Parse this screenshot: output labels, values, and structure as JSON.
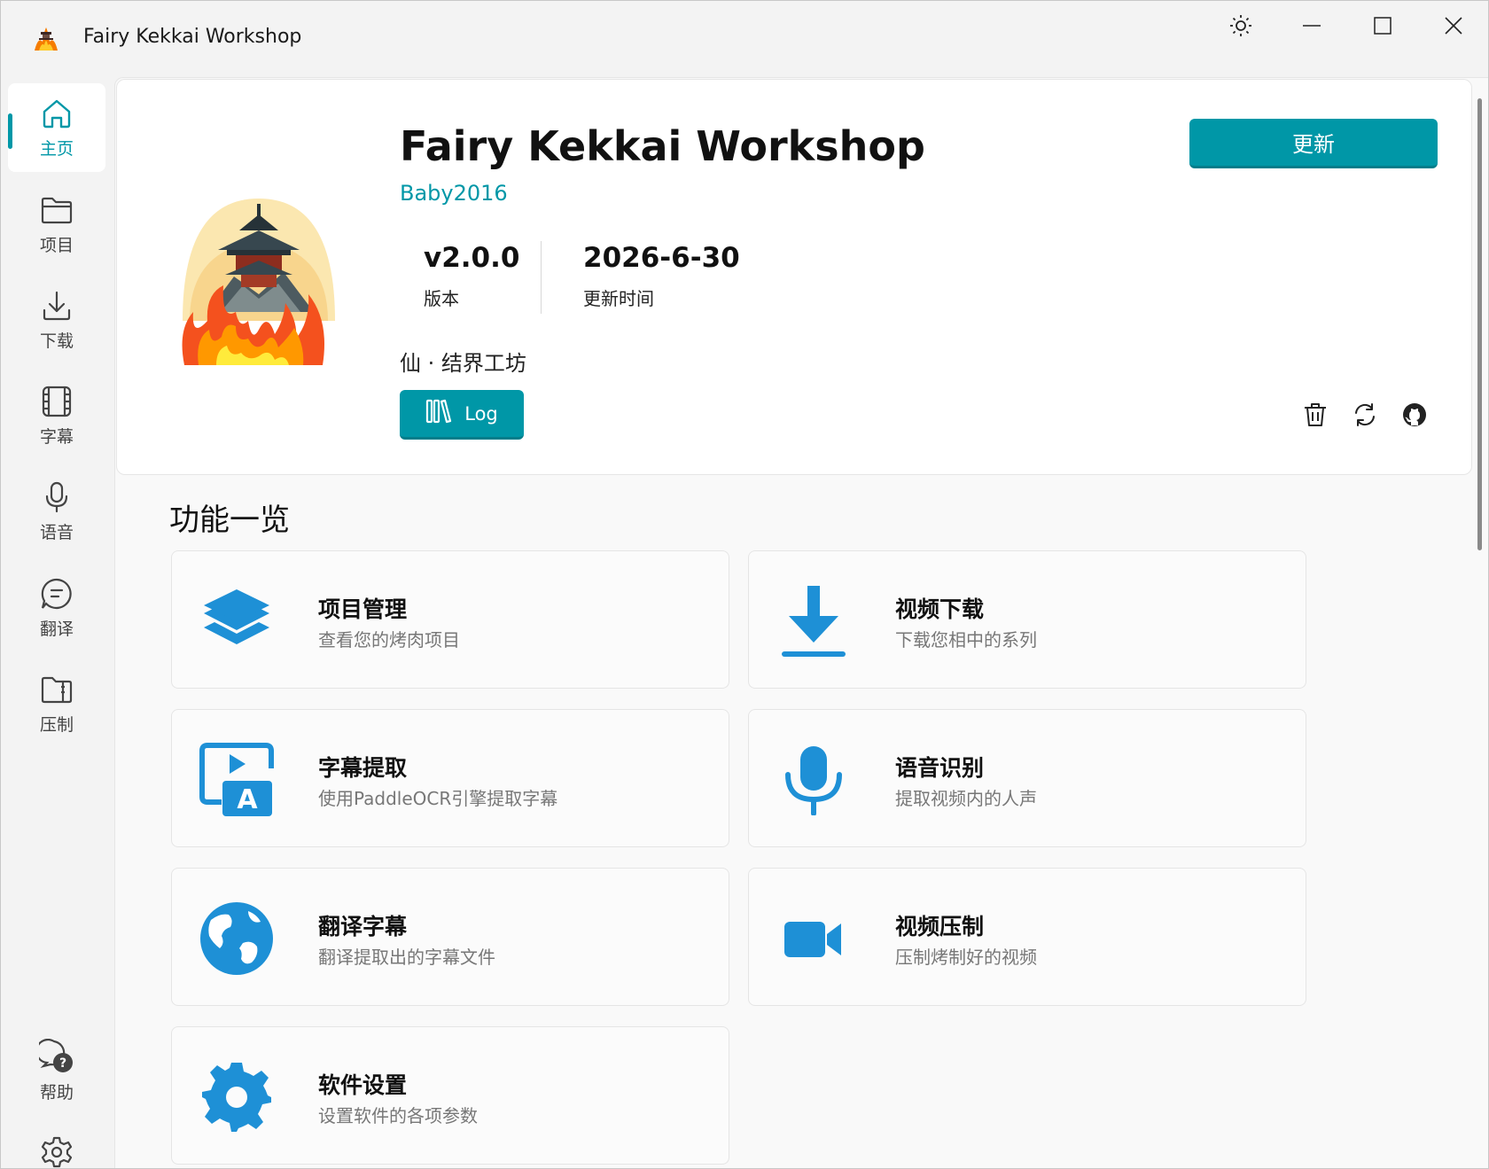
{
  "window": {
    "title": "Fairy Kekkai Workshop"
  },
  "sidebar": {
    "items": [
      {
        "label": "主页",
        "icon": "home-icon",
        "active": true
      },
      {
        "label": "项目",
        "icon": "folder-icon"
      },
      {
        "label": "下载",
        "icon": "download-icon"
      },
      {
        "label": "字幕",
        "icon": "film-icon"
      },
      {
        "label": "语音",
        "icon": "microphone-icon"
      },
      {
        "label": "翻译",
        "icon": "chat-icon"
      },
      {
        "label": "压制",
        "icon": "archive-icon"
      }
    ],
    "bottom": [
      {
        "label": "帮助",
        "icon": "help-icon"
      },
      {
        "label": "设置",
        "icon": "gear-icon"
      }
    ]
  },
  "hero": {
    "title": "Fairy Kekkai Workshop",
    "author": "Baby2016",
    "version_value": "v2.0.0",
    "version_label": "版本",
    "date_value": "2026-6-30",
    "date_label": "更新时间",
    "subtitle": "仙 · 结界工坊",
    "log_label": "Log",
    "update_label": "更新"
  },
  "features": {
    "title": "功能一览",
    "cards": [
      {
        "title": "项目管理",
        "desc": "查看您的烤肉项目",
        "icon": "layers-icon"
      },
      {
        "title": "视频下载",
        "desc": "下载您相中的系列",
        "icon": "download-arrow-icon"
      },
      {
        "title": "字幕提取",
        "desc": "使用PaddleOCR引擎提取字幕",
        "icon": "subtitle-extract-icon"
      },
      {
        "title": "语音识别",
        "desc": "提取视频内的人声",
        "icon": "microphone-icon"
      },
      {
        "title": "翻译字幕",
        "desc": "翻译提取出的字幕文件",
        "icon": "globe-icon"
      },
      {
        "title": "视频压制",
        "desc": "压制烤制好的视频",
        "icon": "video-camera-icon"
      },
      {
        "title": "软件设置",
        "desc": "设置软件的各项参数",
        "icon": "settings-gear-icon"
      }
    ]
  },
  "colors": {
    "accent": "#0097a7",
    "feature_icon": "#1e90d6"
  }
}
